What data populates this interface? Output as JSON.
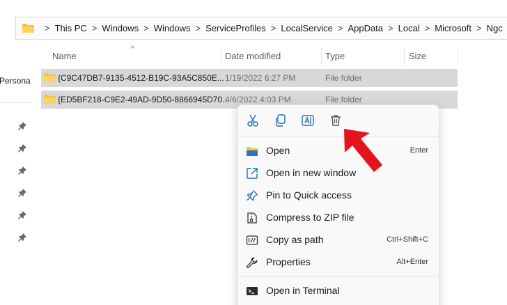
{
  "address_bar": {
    "crumbs": [
      "This PC",
      "Windows",
      "Windows",
      "ServiceProfiles",
      "LocalService",
      "AppData",
      "Local",
      "Microsoft",
      "Ngc"
    ],
    "separator": ">"
  },
  "nav_pane": {
    "label": "Persona",
    "pinned_count": 6
  },
  "columns": {
    "name": "Name",
    "date_modified": "Date modified",
    "type": "Type",
    "size": "Size",
    "sort_indicator": "^"
  },
  "files": [
    {
      "name": "{C9C47DB7-9135-4512-B19C-93A5C850E...",
      "date": "1/19/2022 6:27 PM",
      "type": "File folder",
      "selected": true
    },
    {
      "name": "{ED5BF218-C9E2-49AD-9D50-8866945D70...",
      "date": "4/6/2022 4:03 PM",
      "type": "File folder",
      "selected": true
    }
  ],
  "context_menu": {
    "quick_actions": [
      "scissors-icon",
      "copy-icon",
      "rename-icon",
      "trash-icon"
    ],
    "items": [
      {
        "label": "Open",
        "shortcut": "Enter",
        "icon": "folder-icon"
      },
      {
        "label": "Open in new window",
        "shortcut": "",
        "icon": "open-new-window-icon"
      },
      {
        "label": "Pin to Quick access",
        "shortcut": "",
        "icon": "pin-icon"
      },
      {
        "label": "Compress to ZIP file",
        "shortcut": "",
        "icon": "zip-icon"
      },
      {
        "label": "Copy as path",
        "shortcut": "Ctrl+Shift+C",
        "icon": "copy-path-icon"
      },
      {
        "label": "Properties",
        "shortcut": "Alt+Enter",
        "icon": "wrench-icon"
      },
      {
        "label": "Open in Terminal",
        "shortcut": "",
        "icon": "terminal-icon"
      }
    ]
  },
  "colors": {
    "selection": "#d8d8d8",
    "accent_blue": "#1f6fbf",
    "folder_yellow": "#f5c33b",
    "arrow_red": "#e3141b"
  }
}
